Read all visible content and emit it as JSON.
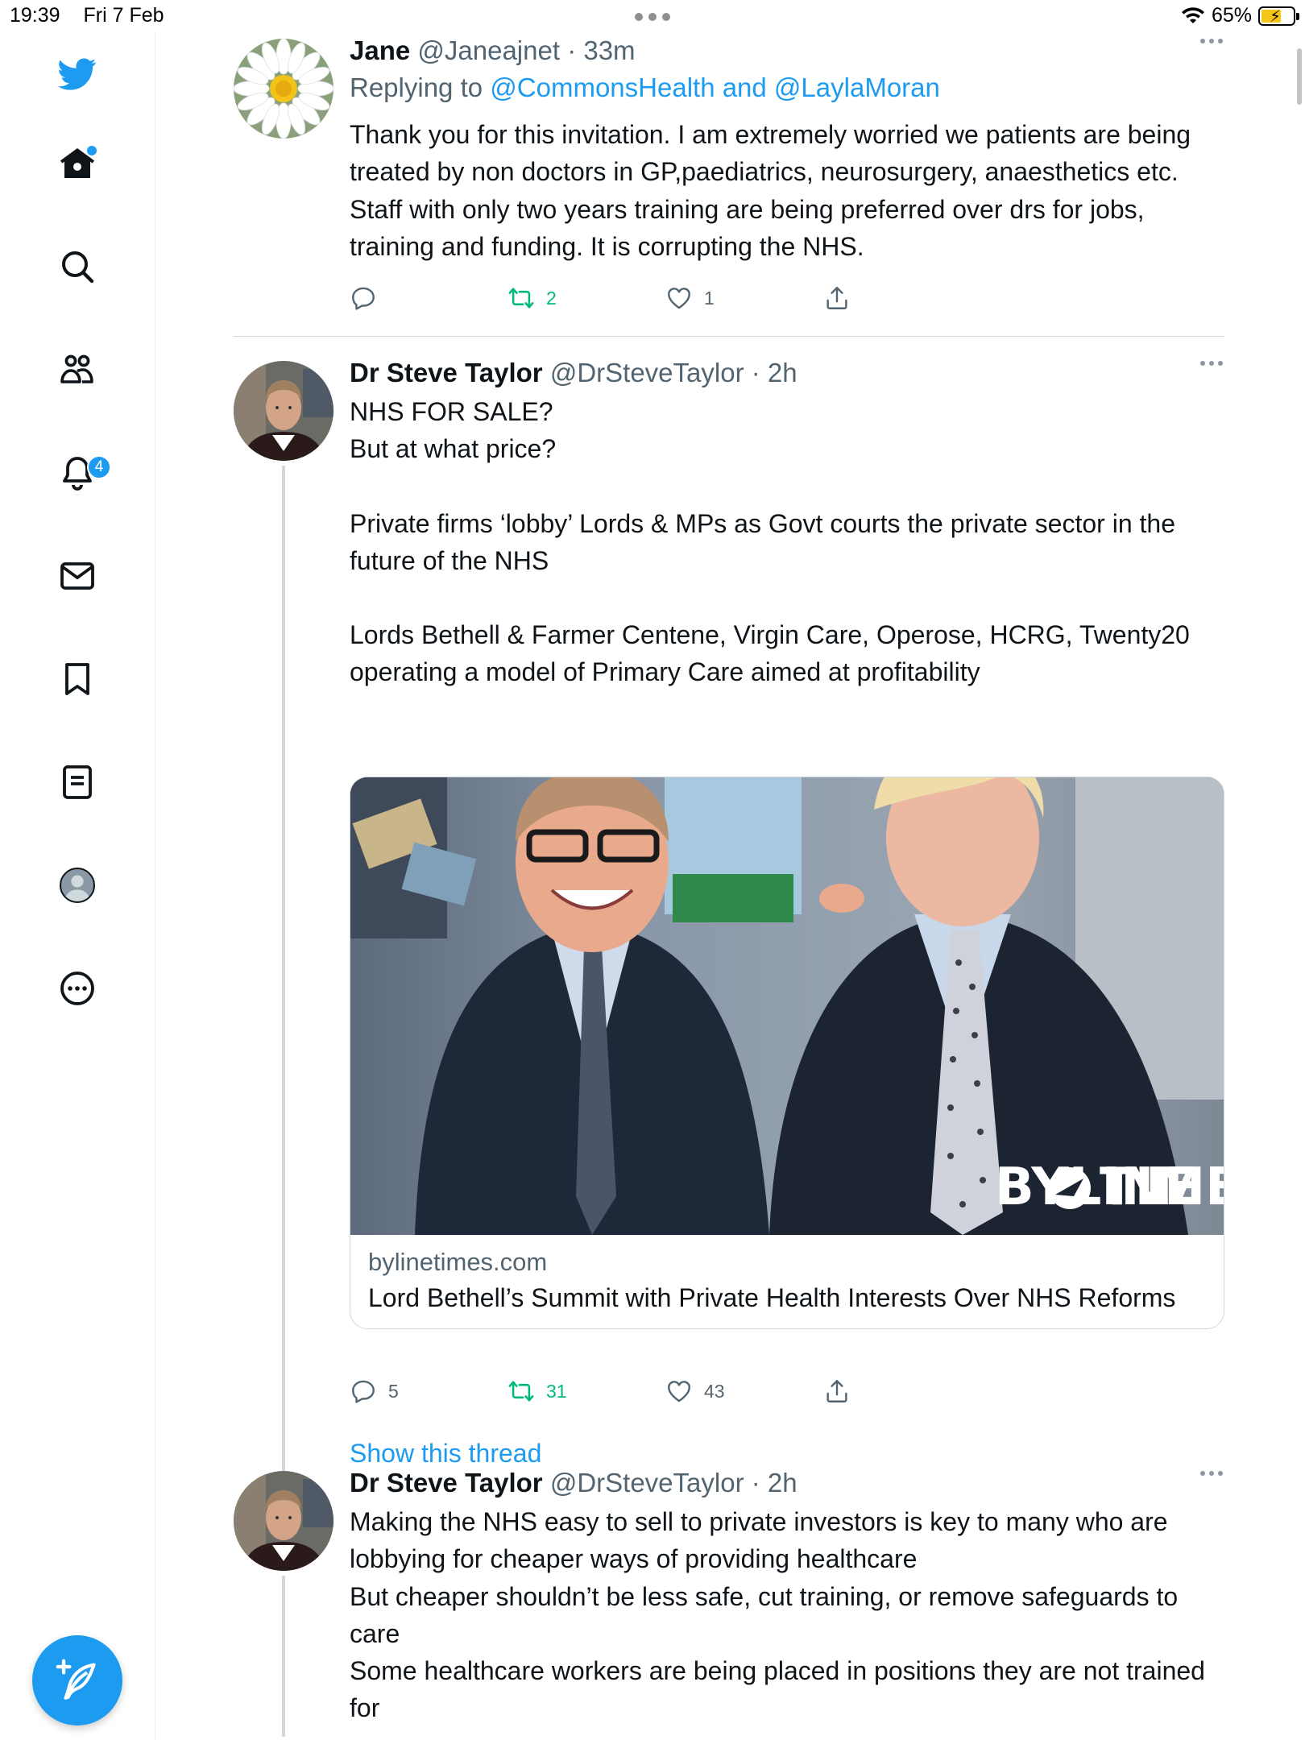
{
  "status_bar": {
    "time": "19:39",
    "date": "Fri 7 Feb",
    "battery": "65%"
  },
  "sidebar": {
    "notifications_badge": "4",
    "items": [
      "twitter-logo",
      "home",
      "explore",
      "communities",
      "notifications",
      "messages",
      "bookmarks",
      "lists",
      "profile",
      "more"
    ]
  },
  "tweets": [
    {
      "name": "Jane",
      "handle": "@Janeajnet",
      "time": "· 33m",
      "replying_prefix": "Replying to",
      "replying_to": "@CommonsHealth and @LaylaMoran",
      "text": "Thank you for this invitation.  I am extremely worried we patients are being treated by non doctors in GP,paediatrics, neurosurgery, anaesthetics etc. Staff with only two years training are being preferred over drs for jobs, training and funding. It is corrupting the NHS.",
      "replies": "",
      "retweets": "2",
      "likes": "1"
    },
    {
      "name": "Dr Steve Taylor",
      "handle": "@DrSteveTaylor",
      "time": "· 2h",
      "lines": [
        "NHS FOR SALE?",
        "But at what price?",
        "",
        "Private firms ‘lobby’ Lords & MPs as Govt courts the private sector in the future of the NHS",
        "",
        "Lords Bethell & Farmer Centene, Virgin Care, Operose, HCRG, Twenty20",
        "operating a model of Primary Care aimed at profitability"
      ],
      "card": {
        "domain": "bylinetimes.com",
        "title": "Lord Bethell’s Summit with Private Health Interests Over NHS Reforms",
        "watermark_left": "BYLINE",
        "watermark_right": "TIMES"
      },
      "replies": "5",
      "retweets": "31",
      "likes": "43",
      "show_thread": "Show this thread"
    },
    {
      "name": "Dr Steve Taylor",
      "handle": "@DrSteveTaylor",
      "time": "· 2h",
      "text": "Making the NHS easy to sell to private investors is key to many who are lobbying for cheaper ways of providing healthcare\nBut cheaper shouldn’t be less safe, cut training, or remove safeguards to care\nSome healthcare workers are being placed in positions they are not trained for"
    }
  ],
  "colors": {
    "accent": "#1d9bf0",
    "retweet": "#00ba7c",
    "secondary_text": "#536471",
    "divider": "#cfd9de"
  }
}
